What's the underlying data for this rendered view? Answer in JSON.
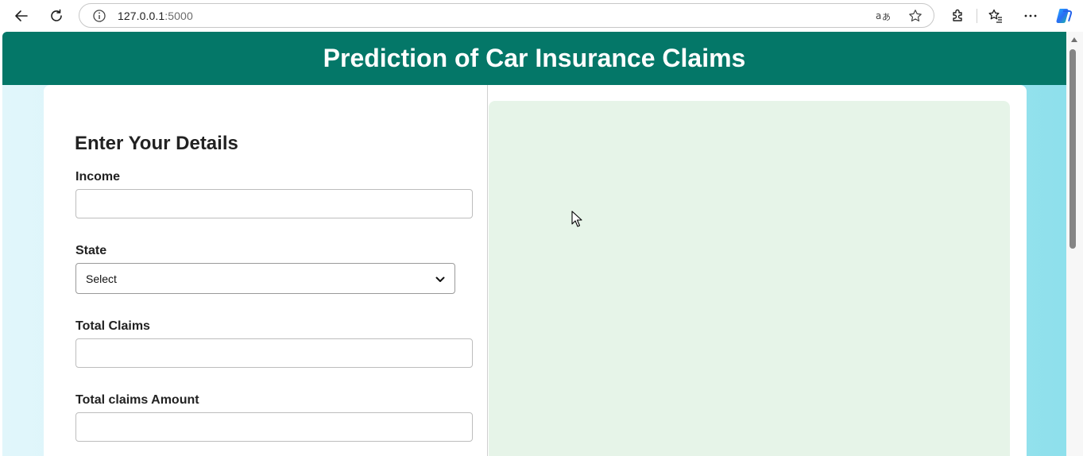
{
  "browser": {
    "url_host": "127.0.0.1",
    "url_port": ":5000",
    "icons": [
      "back-arrow-icon",
      "refresh-icon",
      "info-icon",
      "translate-icon",
      "star-icon",
      "extensions-icon",
      "favorites-icon",
      "more-icon",
      "copilot-icon"
    ]
  },
  "page": {
    "title": "Prediction of Car Insurance Claims",
    "form": {
      "heading": "Enter Your Details",
      "income_label": "Income",
      "income_value": "",
      "state_label": "State",
      "state_selected": "Select",
      "total_claims_label": "Total Claims",
      "total_claims_value": "",
      "total_claims_amount_label": "Total claims Amount",
      "total_claims_amount_value": ""
    }
  },
  "colors": {
    "header_bg": "#047768",
    "result_panel_bg": "#e6f4e8",
    "page_bg_gradient": [
      "#e1f6fb",
      "#8ee0ec"
    ]
  }
}
